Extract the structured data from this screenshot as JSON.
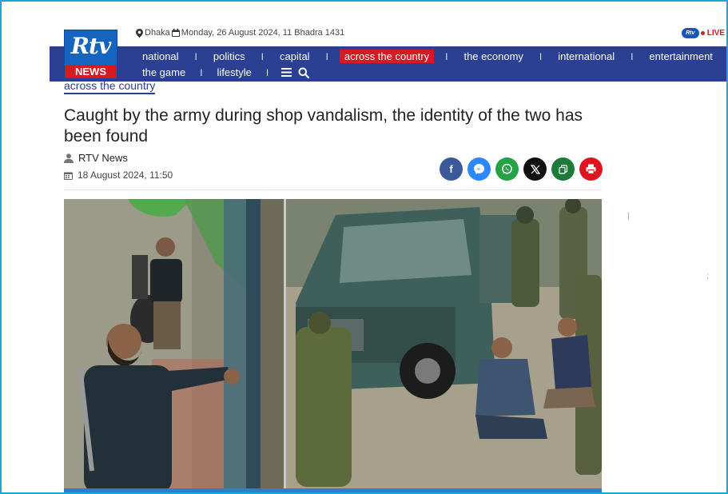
{
  "topbar": {
    "location": "Dhaka",
    "date": "Monday, 26 August 2024, 11 Bhadra 1431",
    "live_logo": "Rtv",
    "live_label": "LIVE"
  },
  "logo": {
    "text": "Rtv",
    "subtext": "NEWS"
  },
  "nav": {
    "row1": [
      "national",
      "politics",
      "capital",
      "across the country",
      "the economy",
      "international",
      "entertainment"
    ],
    "row2": [
      "the game",
      "lifestyle"
    ],
    "active": "across the country",
    "separator": "I"
  },
  "article": {
    "category": "across the country",
    "title": "Caught by the army during shop vandalism, the identity of the two has been found",
    "author": "RTV News",
    "date": "18 August 2024, 11:50"
  },
  "share": [
    {
      "name": "facebook",
      "glyph": "f",
      "color": "#3b5998"
    },
    {
      "name": "messenger",
      "glyph": "m",
      "color": "#2d88ff"
    },
    {
      "name": "whatsapp",
      "glyph": "w",
      "color": "#25a244"
    },
    {
      "name": "x",
      "glyph": "𝕏",
      "color": "#111111"
    },
    {
      "name": "copy",
      "glyph": "⧉",
      "color": "#1e7a3a"
    },
    {
      "name": "print",
      "glyph": "⎙",
      "color": "#e0141e"
    }
  ],
  "colors": {
    "nav_bg": "#2b3f93",
    "active_bg": "#d71a21",
    "frame": "#19a6dc"
  }
}
